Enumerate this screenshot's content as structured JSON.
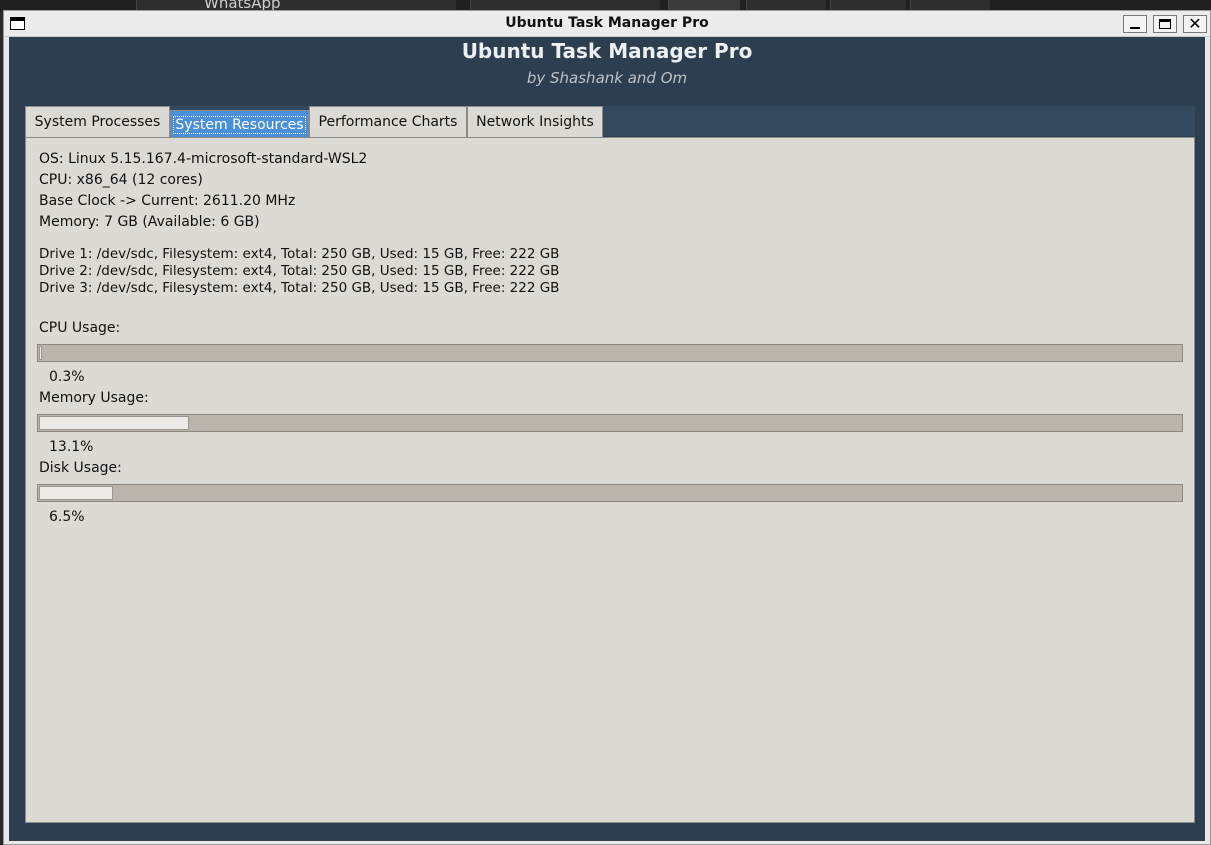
{
  "host": {
    "tab_text": "WhatsApp"
  },
  "window": {
    "title": "Ubuntu Task Manager Pro"
  },
  "app": {
    "title": "Ubuntu Task Manager Pro",
    "subtitle": "by Shashank and Om"
  },
  "tabs": [
    {
      "label": "System Processes",
      "active": false
    },
    {
      "label": "System Resources",
      "active": true
    },
    {
      "label": "Performance Charts",
      "active": false
    },
    {
      "label": "Network Insights",
      "active": false
    }
  ],
  "system": {
    "os": "OS: Linux 5.15.167.4-microsoft-standard-WSL2",
    "cpu": "CPU: x86_64 (12 cores)",
    "clock": "Base Clock -> Current: 2611.20 MHz",
    "memory": "Memory: 7 GB (Available: 6 GB)"
  },
  "drives": [
    "Drive 1: /dev/sdc, Filesystem: ext4, Total: 250 GB, Used: 15 GB, Free: 222 GB",
    "Drive 2: /dev/sdc, Filesystem: ext4, Total: 250 GB, Used: 15 GB, Free: 222 GB",
    "Drive 3: /dev/sdc, Filesystem: ext4, Total: 250 GB, Used: 15 GB, Free: 222 GB"
  ],
  "usage": {
    "cpu": {
      "label": "CPU Usage:",
      "percent_text": "0.3%",
      "percent": 0.3
    },
    "memory": {
      "label": "Memory Usage:",
      "percent_text": "13.1%",
      "percent": 13.1
    },
    "disk": {
      "label": "Disk Usage:",
      "percent_text": "6.5%",
      "percent": 6.5
    }
  },
  "colors": {
    "header_bg": "#2c3e50",
    "tab_active": "#4a90d9",
    "content_bg": "#dcdad5"
  }
}
